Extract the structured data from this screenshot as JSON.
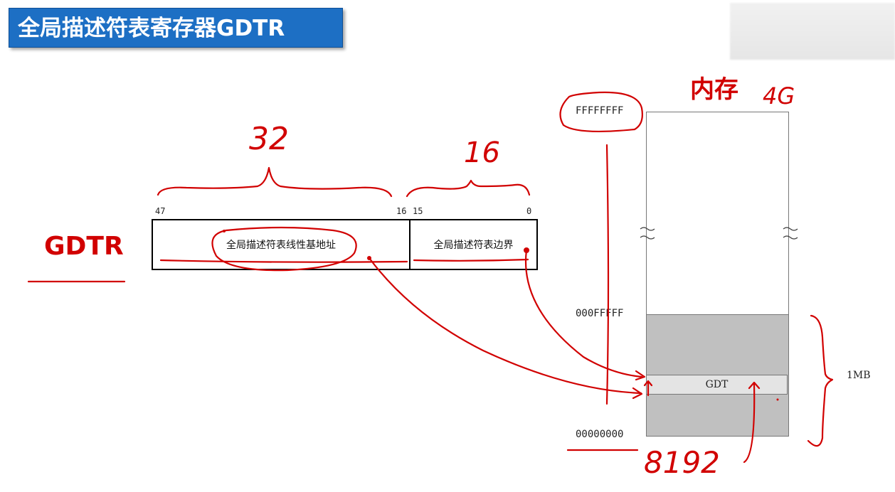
{
  "title": "全局描述符表寄存器GDTR",
  "register": {
    "label": "GDTR",
    "base_field": "全局描述符表线性基地址",
    "limit_field": "全局描述符表边界",
    "bits": {
      "b47": "47",
      "b16": "16",
      "b15": "15",
      "b0": "0"
    },
    "base_width": "32",
    "limit_width": "16"
  },
  "memory": {
    "title": "内存",
    "size_note": "4G",
    "addr_top": "FFFFFFFF",
    "addr_1mb": "000FFFFF",
    "addr_bottom": "00000000",
    "gdt_label": "GDT",
    "region_label": "1MB",
    "entries_note": "8192"
  },
  "colors": {
    "banner": "#1d6fc4",
    "ink": "#d10000",
    "memory_gray": "#c0c0c0",
    "gdt_fill": "#e4e4e4"
  }
}
